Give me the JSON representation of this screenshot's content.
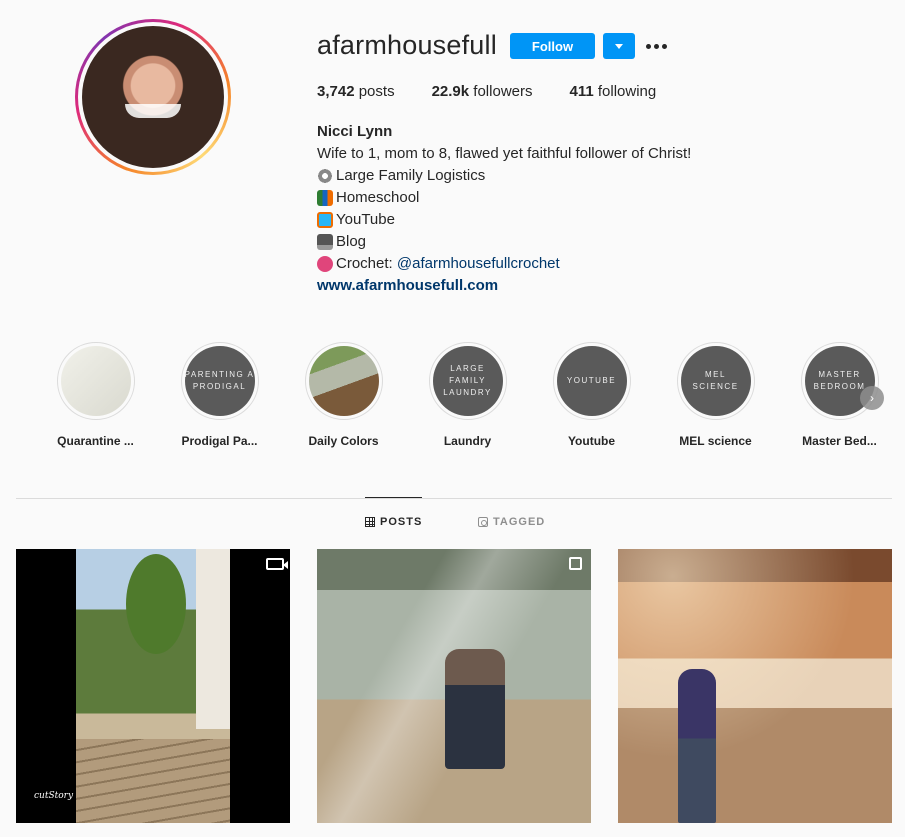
{
  "profile": {
    "username": "afarmhousefull",
    "follow_label": "Follow",
    "stats": {
      "posts_count": "3,742",
      "posts_label": "posts",
      "followers_count": "22.9k",
      "followers_label": "followers",
      "following_count": "411",
      "following_label": "following"
    },
    "bio": {
      "name": "Nicci Lynn",
      "line1": "Wife to 1, mom to 8, flawed yet faithful follower of Christ!",
      "line2": "Large Family Logistics",
      "line3": "Homeschool",
      "line4": "YouTube",
      "line5": "Blog",
      "line6_prefix": "Crochet: ",
      "line6_mention": "@afarmhousefullcrochet",
      "website": "www.afarmhousefull.com"
    }
  },
  "highlights": [
    {
      "label": "Quarantine ...",
      "cover_text": ""
    },
    {
      "label": "Prodigal Pa...",
      "cover_text": "PARENTING A PRODIGAL"
    },
    {
      "label": "Daily Colors",
      "cover_text": ""
    },
    {
      "label": "Laundry",
      "cover_text": "LARGE FAMILY LAUNDRY"
    },
    {
      "label": "Youtube",
      "cover_text": "YOUTUBE"
    },
    {
      "label": "MEL science",
      "cover_text": "MEL SCIENCE"
    },
    {
      "label": "Master Bed...",
      "cover_text": "MASTER BEDROOM"
    }
  ],
  "tabs": {
    "posts": "POSTS",
    "tagged": "TAGGED"
  },
  "posts": {
    "post1_brand": "cutStory"
  },
  "colors": {
    "accent": "#0095f6",
    "link": "#00376b"
  }
}
